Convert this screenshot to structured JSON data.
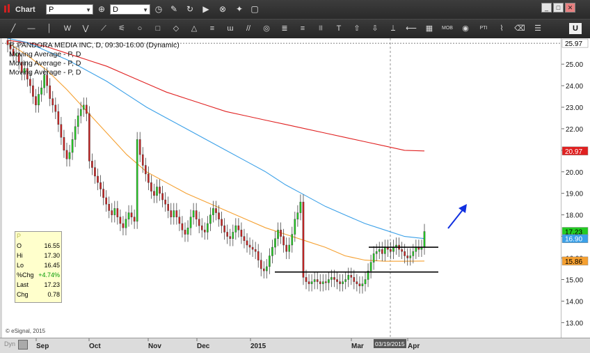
{
  "window": {
    "title": "Chart",
    "symbol": "P",
    "interval": "D",
    "controls": [
      "_",
      "□",
      "✕"
    ]
  },
  "toolbar": {
    "tools": [
      "╱",
      "—",
      "│",
      "W",
      "⋁",
      "⟋",
      "⚟",
      "○",
      "□",
      "◇",
      "△",
      "≡",
      "ɯ",
      "//",
      "◎",
      "≣",
      "≡",
      "|||",
      "T",
      "⇧",
      "⇩",
      "⟘",
      "⟵",
      "▦",
      "MOB",
      "◉",
      "PTI",
      "⌇",
      "⌫",
      "☰",
      "U"
    ]
  },
  "legend": {
    "main": "P, PANDORA MEDIA INC, D, 09:30-16:00 (Dynamic)",
    "ma1": "Moving Average - P, D",
    "ma2": "Moving Average - P, D",
    "ma3": "Moving Average - P, D"
  },
  "databox": {
    "symbol": "P",
    "rows": [
      {
        "k": "O",
        "v": "16.55",
        "color": "#000000"
      },
      {
        "k": "Hi",
        "v": "17.30",
        "color": "#000000"
      },
      {
        "k": "Lo",
        "v": "16.45",
        "color": "#000000"
      },
      {
        "k": "%Chg",
        "v": "+4.74%",
        "color": "#009900"
      },
      {
        "k": "Last",
        "v": "17.23",
        "color": "#000000"
      },
      {
        "k": "Chg",
        "v": "0.78",
        "color": "#000000"
      }
    ]
  },
  "copyright": "© eSignal, 2015",
  "xaxis": {
    "corner": "Dyn",
    "crosshair_date": "03/19/2015"
  },
  "colors": {
    "up": "#22cc22",
    "down": "#cc2222",
    "ma_fast": "#f5a030",
    "ma_mid": "#3aa0e8",
    "ma_slow": "#e02020",
    "arrow": "#1030e0"
  },
  "chart_data": {
    "type": "candlestick",
    "title": "P, PANDORA MEDIA INC, D, 09:30-16:00 (Dynamic)",
    "x_labels": [
      "Sep",
      "Oct",
      "Nov",
      "Dec",
      "2015",
      "Mar",
      "Apr"
    ],
    "y_ticks": [
      "13.00",
      "14.00",
      "15.00",
      "16.00",
      "17.00",
      "18.00",
      "19.00",
      "20.00",
      "21.00",
      "22.00",
      "23.00",
      "24.00",
      "25.00"
    ],
    "ylim": [
      12.3,
      26.2
    ],
    "price_tags": [
      {
        "label": "25.97",
        "value": 25.97,
        "bg": "#ffffff",
        "fg": "#000000"
      },
      {
        "label": "20.97",
        "value": 20.97,
        "bg": "#e02020",
        "fg": "#ffffff"
      },
      {
        "label": "17.23",
        "value": 17.23,
        "bg": "#22cc22",
        "fg": "#000000"
      },
      {
        "label": "16.90",
        "value": 16.9,
        "bg": "#3aa0e8",
        "fg": "#ffffff"
      },
      {
        "label": "15.86",
        "value": 15.86,
        "bg": "#f5a030",
        "fg": "#000000"
      }
    ],
    "support_line": 15.35,
    "resistance_line": 16.5,
    "ma_slow": [
      26.1,
      26.0,
      25.8,
      25.5,
      25.2,
      24.9,
      24.5,
      24.1,
      23.7,
      23.4,
      23.1,
      22.8,
      22.6,
      22.4,
      22.2,
      22.0,
      21.8,
      21.6,
      21.4,
      21.2,
      21.0,
      20.97
    ],
    "ma_mid": [
      26.2,
      26.0,
      25.6,
      25.2,
      24.7,
      24.2,
      23.6,
      23.0,
      22.5,
      22.0,
      21.5,
      21.0,
      20.5,
      20.0,
      19.4,
      18.9,
      18.4,
      18.0,
      17.6,
      17.3,
      17.0,
      16.9
    ],
    "ma_fast": [
      26.0,
      25.4,
      24.7,
      23.8,
      22.8,
      21.8,
      20.8,
      20.0,
      19.5,
      19.0,
      18.6,
      18.2,
      17.8,
      17.4,
      17.1,
      16.8,
      16.5,
      16.1,
      15.9,
      15.85,
      15.85,
      15.86
    ],
    "closes": [
      25.9,
      25.7,
      25.4,
      25.5,
      25.1,
      24.6,
      24.8,
      24.3,
      24.0,
      23.5,
      23.1,
      23.6,
      23.9,
      24.5,
      24.0,
      23.4,
      23.1,
      22.8,
      22.2,
      21.6,
      21.0,
      20.6,
      20.9,
      21.5,
      22.1,
      22.6,
      22.9,
      23.1,
      22.7,
      20.5,
      20.2,
      19.8,
      19.5,
      19.2,
      18.8,
      18.5,
      18.2,
      18.0,
      18.3,
      17.9,
      17.6,
      17.4,
      17.8,
      18.1,
      17.9,
      17.7,
      21.5,
      20.8,
      20.3,
      19.9,
      19.5,
      19.1,
      18.9,
      19.3,
      19.0,
      18.7,
      18.5,
      18.2,
      17.9,
      18.2,
      17.9,
      17.6,
      17.3,
      17.1,
      17.4,
      17.9,
      18.2,
      17.8,
      17.5,
      17.3,
      17.2,
      17.6,
      18.0,
      18.3,
      18.1,
      17.8,
      17.5,
      17.2,
      17.0,
      16.9,
      17.2,
      17.5,
      17.3,
      17.0,
      16.8,
      16.6,
      16.5,
      16.4,
      16.3,
      15.9,
      15.5,
      15.4,
      15.6,
      16.1,
      16.5,
      16.9,
      17.3,
      17.0,
      16.6,
      16.3,
      16.6,
      17.1,
      17.8,
      18.1,
      18.6,
      15.1,
      14.9,
      14.8,
      14.9,
      15.0,
      14.9,
      14.8,
      14.9,
      14.85,
      15.0,
      15.1,
      15.0,
      14.9,
      14.8,
      14.9,
      15.0,
      15.2,
      15.1,
      14.9,
      14.8,
      14.7,
      14.8,
      15.0,
      15.4,
      15.8,
      16.2,
      16.3,
      16.4,
      16.2,
      16.5,
      16.4,
      16.3,
      16.5,
      16.6,
      16.4,
      16.3,
      16.1,
      16.0,
      16.1,
      16.3,
      16.5,
      16.4,
      16.5,
      17.23
    ]
  }
}
